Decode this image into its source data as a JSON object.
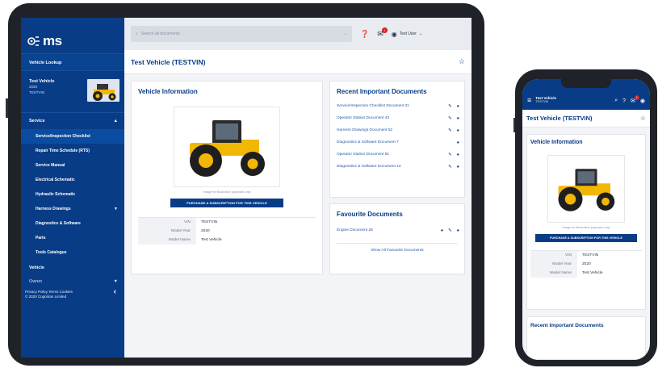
{
  "app": {
    "logo_text": "ms",
    "vehicle_lookup": "Vehicle Lookup",
    "vehicle": {
      "name": "Test Vehicle",
      "year": "2020",
      "vin": "TESTVIN"
    },
    "nav": {
      "service_header": "Service",
      "items": [
        "Service/Inspection Checklist",
        "Repair Time Schedule (RTS)",
        "Service Manual",
        "Electrical Schematic",
        "Hydraulic Schematic",
        "Harness Drawings",
        "Diagnostics & Software",
        "Parts",
        "Tools Catalogue"
      ],
      "vehicle_header": "Vehicle",
      "owner_header": "Owner"
    },
    "footer": {
      "links": "Privacy Policy  Terms  Cookies",
      "copyright": "© 2020 Cognitran Limited"
    },
    "search_placeholder": "Search all documents",
    "notification_count": "1",
    "user_label": "Test User",
    "page_title": "Test Vehicle (TESTVIN)",
    "vehicle_info": {
      "title": "Vehicle Information",
      "caption": "Image for illustration purposes only",
      "buy_button": "PURCHASE A SUBSCRIPTION FOR THIS VEHICLE",
      "specs": [
        {
          "key": "VIN",
          "value": "TESTVIN"
        },
        {
          "key": "Model Year",
          "value": "2020"
        },
        {
          "key": "Model Name",
          "value": "Test Vehicle"
        }
      ]
    },
    "recent_docs": {
      "title": "Recent Important Documents",
      "items": [
        "Service/Inspection Checklist Document 31",
        "Operator Station Document 43",
        "Harness Drawings Document 52",
        "Diagnostics & Software Document 7",
        "Operator Station Document 81",
        "Diagnostics & Software Document 13"
      ]
    },
    "favourites": {
      "title": "Favourite Documents",
      "items": [
        "Engine Document 26"
      ],
      "show_all": "Show All Favourite Documents"
    }
  },
  "phone": {
    "vehicle_name": "Test Vehicle",
    "vehicle_vin": "TESTVIN",
    "page_title": "Test Vehicle (TESTVIN)",
    "vehicle_info_title": "Vehicle Information",
    "caption": "Image for illustration purposes only",
    "buy_button": "PURCHASE A SUBSCRIPTION FOR THIS VEHICLE",
    "recent_docs_title": "Recent Important Documents"
  },
  "colors": {
    "brand": "#083c86",
    "badge": "#d81f26",
    "tractor_yellow": "#f2b705"
  }
}
